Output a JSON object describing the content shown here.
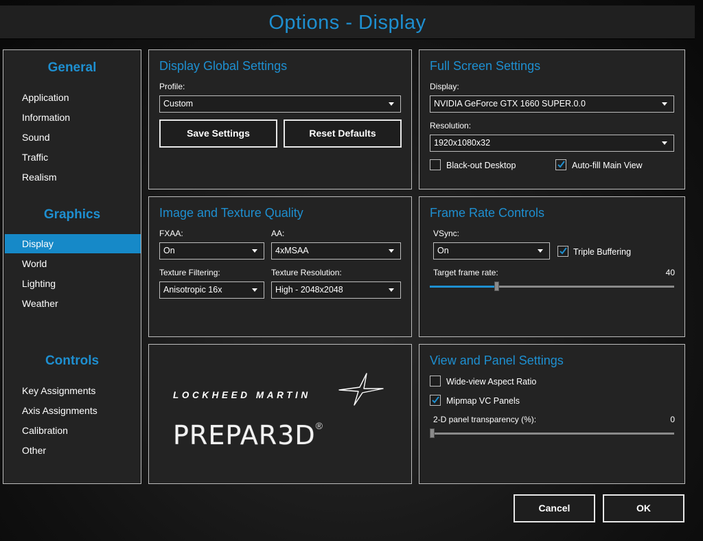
{
  "window": {
    "title": "Options - Display"
  },
  "sidebar": {
    "sections": [
      {
        "heading": "General",
        "items": [
          "Application",
          "Information",
          "Sound",
          "Traffic",
          "Realism"
        ]
      },
      {
        "heading": "Graphics",
        "items": [
          "Display",
          "World",
          "Lighting",
          "Weather"
        ]
      },
      {
        "heading": "Controls",
        "items": [
          "Key Assignments",
          "Axis Assignments",
          "Calibration",
          "Other"
        ]
      }
    ],
    "active_item": "Display"
  },
  "global": {
    "title": "Display Global Settings",
    "profile_label": "Profile:",
    "profile_value": "Custom",
    "save_label": "Save Settings",
    "reset_label": "Reset Defaults"
  },
  "fullscreen": {
    "title": "Full Screen Settings",
    "display_label": "Display:",
    "display_value": "NVIDIA GeForce GTX 1660 SUPER.0.0",
    "resolution_label": "Resolution:",
    "resolution_value": "1920x1080x32",
    "blackout_label": "Black-out Desktop",
    "blackout_checked": false,
    "autofill_label": "Auto-fill Main View",
    "autofill_checked": true
  },
  "quality": {
    "title": "Image and Texture Quality",
    "fxaa_label": "FXAA:",
    "fxaa_value": "On",
    "aa_label": "AA:",
    "aa_value": "4xMSAA",
    "filtering_label": "Texture Filtering:",
    "filtering_value": "Anisotropic 16x",
    "texres_label": "Texture Resolution:",
    "texres_value": "High - 2048x2048"
  },
  "framerate": {
    "title": "Frame Rate Controls",
    "vsync_label": "VSync:",
    "vsync_value": "On",
    "triple_label": "Triple Buffering",
    "triple_checked": true,
    "target_label": "Target frame rate:",
    "target_value": "40",
    "target_fraction": 0.27
  },
  "logo": {
    "company": "LOCKHEED MARTIN",
    "product": "PREPAR3D",
    "registered": "®"
  },
  "view": {
    "title": "View and Panel Settings",
    "wideview_label": "Wide-view Aspect Ratio",
    "wideview_checked": false,
    "mipmap_label": "Mipmap VC Panels",
    "mipmap_checked": true,
    "transparency_label": "2-D panel transparency (%):",
    "transparency_value": "0",
    "transparency_fraction": 0.0
  },
  "footer": {
    "cancel_label": "Cancel",
    "ok_label": "OK"
  },
  "colors": {
    "accent": "#1e8fd0",
    "active_nav": "#1689c8",
    "panel_bg": "#232323",
    "border": "#bdbdbd"
  }
}
